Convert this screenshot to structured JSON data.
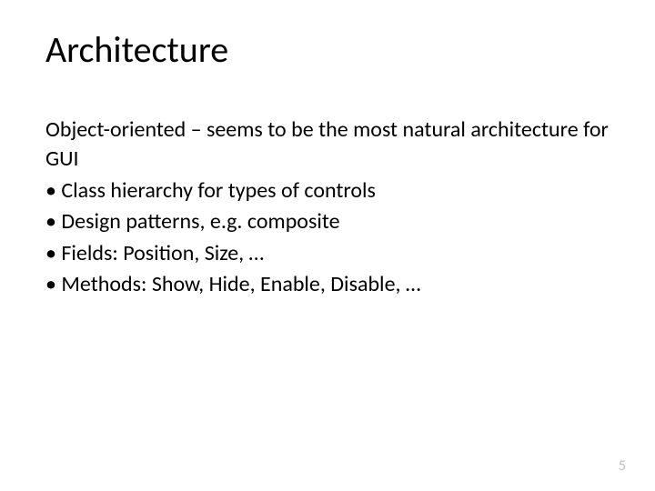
{
  "title": "Architecture",
  "intro": "Object-oriented – seems to be the most natural architecture for GUI",
  "bullets": [
    "• Class hierarchy for types of controls",
    "• Design patterns, e.g. composite",
    "• Fields: Position, Size, …",
    "• Methods: Show, Hide, Enable, Disable, …"
  ],
  "page_number": "5"
}
